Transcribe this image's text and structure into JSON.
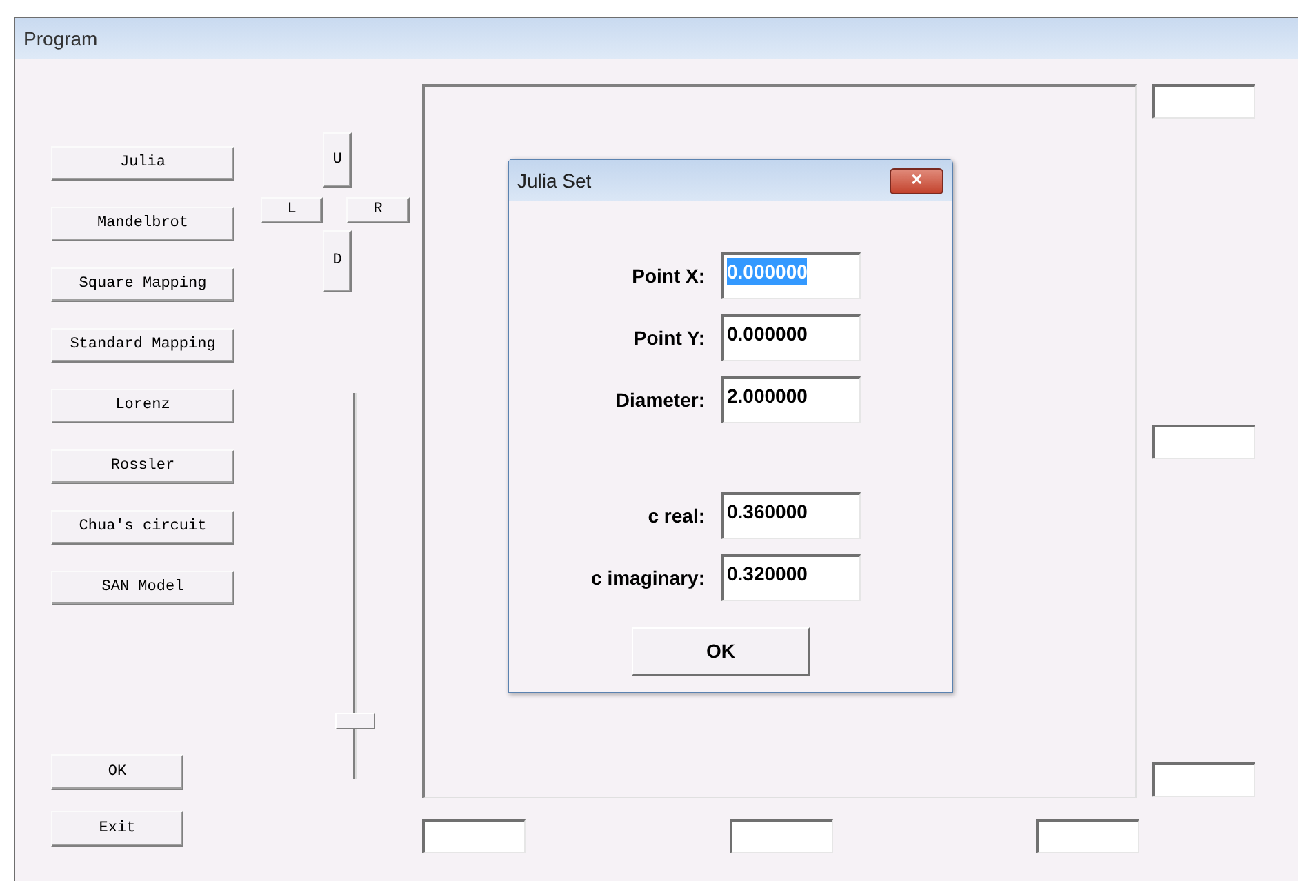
{
  "window": {
    "title": "Program"
  },
  "function_buttons": [
    "Julia",
    "Mandelbrot",
    "Square Mapping",
    "Standard Mapping",
    "Lorenz",
    "Rossler",
    "Chua's circuit",
    "SAN Model"
  ],
  "bottom_buttons": [
    "OK",
    "Exit"
  ],
  "direction_pad": {
    "up": "U",
    "left": "L",
    "right": "R",
    "down": "D"
  },
  "slider": {
    "level": 0.15
  },
  "dialog": {
    "title": "Julia Set",
    "close": "✕",
    "fields": [
      {
        "label": "Point X:",
        "value": "0.000000",
        "selected": true
      },
      {
        "label": "Point Y:",
        "value": "0.000000",
        "selected": false
      },
      {
        "label": "Diameter:",
        "value": "2.000000",
        "selected": false
      },
      {
        "label": "c real:",
        "value": "0.360000",
        "selected": false
      },
      {
        "label": "c imaginary:",
        "value": "0.320000",
        "selected": false
      }
    ],
    "ok": "OK"
  }
}
